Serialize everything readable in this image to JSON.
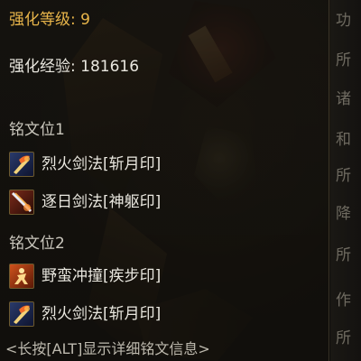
{
  "tooltip": {
    "level_line": "强化等级: 9",
    "exp_line": "强化经验: 181616",
    "slot1": {
      "title": "铭文位1",
      "skills": [
        {
          "name": "烈火剑法[斩月印]",
          "icon": "fire-sword-icon"
        },
        {
          "name": "逐日剑法[神躯印]",
          "icon": "sun-chase-sword-icon"
        }
      ]
    },
    "slot2": {
      "title": "铭文位2",
      "skills": [
        {
          "name": "野蛮冲撞[疾步印]",
          "icon": "savage-charge-icon"
        },
        {
          "name": "烈火剑法[斩月印]",
          "icon": "fire-sword-icon"
        }
      ]
    },
    "hint": "<长按[ALT]显示详细铭文信息>"
  },
  "right_panel": {
    "glyphs": [
      "功",
      "所",
      "诸",
      "和",
      "所",
      "降",
      "所",
      "作",
      "所"
    ]
  },
  "colors": {
    "gold": "#e8b54a",
    "white": "#e9e7df",
    "icon_border": "#6d5a2f"
  }
}
